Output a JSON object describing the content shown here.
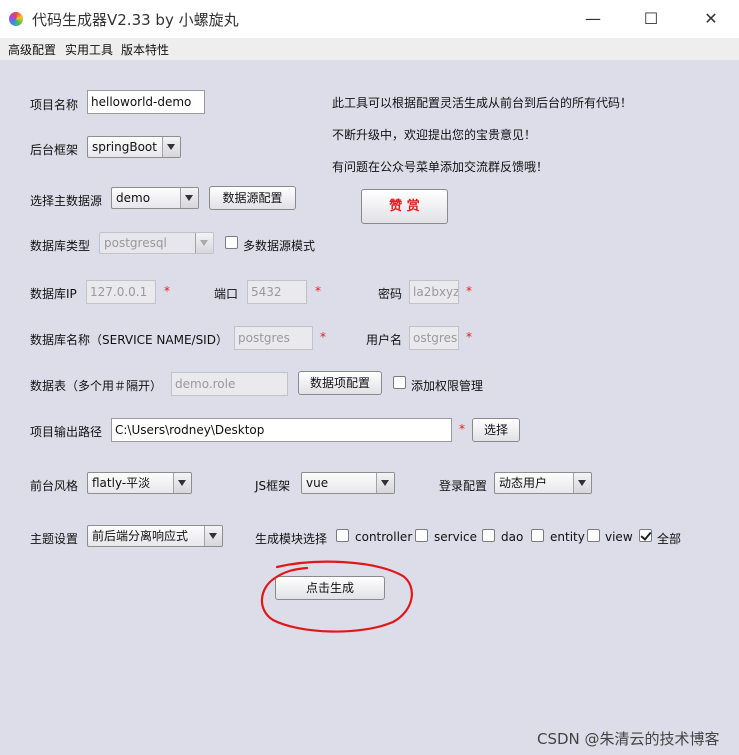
{
  "window": {
    "title": "代码生成器V2.33 by 小螺旋丸",
    "minimize": "—",
    "maximize": "☐",
    "close": "✕"
  },
  "menu": [
    "高级配置",
    "实用工具",
    "版本特性"
  ],
  "info_lines": [
    "此工具可以根据配置灵活生成从前台到后台的所有代码！",
    "不断升级中，欢迎提出您的宝贵意见！",
    "有问题在公众号菜单添加交流群反馈哦！"
  ],
  "donate_button": "赞 赏",
  "form": {
    "project_name": {
      "label": "项目名称",
      "value": "helloworld-demo"
    },
    "backend_framework": {
      "label": "后台框架",
      "value": "springBoot"
    },
    "main_datasource": {
      "label": "选择主数据源",
      "value": "demo",
      "config_button": "数据源配置"
    },
    "db_type": {
      "label": "数据库类型",
      "value": "postgresql",
      "multi_label": "多数据源模式"
    },
    "db_ip": {
      "label": "数据库IP",
      "value": "127.0.0.1"
    },
    "port": {
      "label": "端口",
      "value": "5432"
    },
    "password": {
      "label": "密码",
      "value": "la2bxyz"
    },
    "db_name": {
      "label": "数据库名称（SERVICE NAME/SID）",
      "value": "postgres"
    },
    "username": {
      "label": "用户名",
      "value": "ostgres"
    },
    "tables": {
      "label": "数据表（多个用＃隔开）",
      "value": "demo.role",
      "config_button": "数据项配置",
      "auth_label": "添加权限管理"
    },
    "output_path": {
      "label": "项目输出路径",
      "value": "C:\\Users\\rodney\\Desktop",
      "choose_button": "选择"
    },
    "frontend_style": {
      "label": "前台风格",
      "value": "flatly-平淡"
    },
    "js_framework": {
      "label": "JS框架",
      "value": "vue"
    },
    "login_config": {
      "label": "登录配置",
      "value": "动态用户"
    },
    "theme": {
      "label": "主题设置",
      "value": "前后端分离响应式"
    },
    "modules": {
      "label": "生成模块选择",
      "items": [
        "controller",
        "service",
        "dao",
        "entity",
        "view",
        "全部"
      ],
      "checked": [
        false,
        false,
        false,
        false,
        false,
        true
      ]
    },
    "required_mark": "*"
  },
  "generate_button": "点击生成",
  "watermark": "CSDN @朱清云的技术博客",
  "colors": {
    "required": "#e02020",
    "donate": "#e02020",
    "annotation": "#e01818"
  }
}
